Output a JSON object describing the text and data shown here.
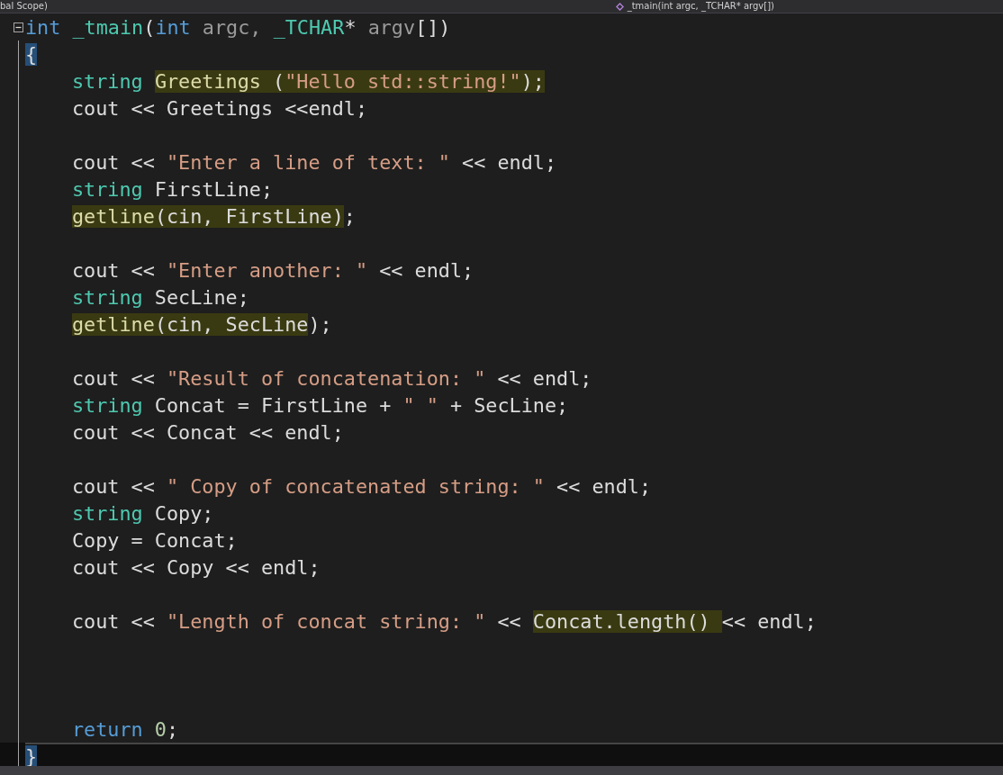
{
  "navigation_bar": {
    "scope": "bal Scope)",
    "member": "_tmain(int argc, _TCHAR* argv[])"
  },
  "lines": [
    {
      "foldable": true,
      "current": false,
      "tokens": [
        {
          "kind": "keyword",
          "text": "int"
        },
        {
          "kind": "identifier",
          "text": " _tmain"
        },
        {
          "kind": "plain",
          "text": "("
        },
        {
          "kind": "keyword",
          "text": "int"
        },
        {
          "kind": "param",
          "text": " argc, "
        },
        {
          "kind": "type",
          "text": "_TCHAR"
        },
        {
          "kind": "plain",
          "text": "* "
        },
        {
          "kind": "param",
          "text": "argv"
        },
        {
          "kind": "plain",
          "text": "[])"
        }
      ]
    },
    {
      "foldable": false,
      "current": false,
      "tokens": [
        {
          "kind": "brace-match",
          "text": "{"
        }
      ],
      "children": [
        {
          "foldable": false,
          "current": false,
          "tokens": [
            {
              "kind": "type",
              "text": "string "
            },
            {
              "kind": "function",
              "text": "Greetings",
              "highlight": true
            },
            {
              "kind": "plain",
              "text": " (",
              "highlight": true
            },
            {
              "kind": "string",
              "text": "\"Hello std::string!\"",
              "highlight": true
            },
            {
              "kind": "plain",
              "text": ");",
              "highlight": true
            }
          ]
        },
        {
          "foldable": false,
          "current": false,
          "tokens": [
            {
              "kind": "plain",
              "text": "cout << Greetings <<endl;"
            }
          ]
        },
        {
          "foldable": false,
          "current": false
        },
        {
          "foldable": false,
          "current": false,
          "tokens": [
            {
              "kind": "plain",
              "text": "cout << "
            },
            {
              "kind": "string",
              "text": "\"Enter a line of text: \""
            },
            {
              "kind": "plain",
              "text": " << endl;"
            }
          ]
        },
        {
          "foldable": false,
          "current": false,
          "tokens": [
            {
              "kind": "type",
              "text": "string"
            },
            {
              "kind": "plain",
              "text": " FirstLine;"
            }
          ]
        },
        {
          "foldable": false,
          "current": false,
          "tokens": [
            {
              "kind": "function",
              "text": "getline",
              "highlight": true
            },
            {
              "kind": "plain",
              "text": "(cin, FirstLine)",
              "highlight": true
            },
            {
              "kind": "plain",
              "text": ";"
            }
          ]
        },
        {
          "foldable": false,
          "current": false
        },
        {
          "foldable": false,
          "current": false,
          "tokens": [
            {
              "kind": "plain",
              "text": "cout << "
            },
            {
              "kind": "string",
              "text": "\"Enter another: \""
            },
            {
              "kind": "plain",
              "text": " << endl;"
            }
          ]
        },
        {
          "foldable": false,
          "current": false,
          "tokens": [
            {
              "kind": "type",
              "text": "string"
            },
            {
              "kind": "plain",
              "text": " SecLine;"
            }
          ]
        },
        {
          "foldable": false,
          "current": false,
          "tokens": [
            {
              "kind": "function",
              "text": "getline",
              "highlight": true
            },
            {
              "kind": "plain",
              "text": "(cin, SecLine",
              "highlight": true
            },
            {
              "kind": "plain",
              "text": ");"
            }
          ]
        },
        {
          "foldable": false,
          "current": false
        },
        {
          "foldable": false,
          "current": false,
          "tokens": [
            {
              "kind": "plain",
              "text": "cout << "
            },
            {
              "kind": "string",
              "text": "\"Result of concatenation: \""
            },
            {
              "kind": "plain",
              "text": " << endl;"
            }
          ]
        },
        {
          "foldable": false,
          "current": false,
          "tokens": [
            {
              "kind": "type",
              "text": "string"
            },
            {
              "kind": "plain",
              "text": " Concat = FirstLine + "
            },
            {
              "kind": "string",
              "text": "\" \""
            },
            {
              "kind": "plain",
              "text": " + SecLine;"
            }
          ]
        },
        {
          "foldable": false,
          "current": false,
          "tokens": [
            {
              "kind": "plain",
              "text": "cout << Concat << endl;"
            }
          ]
        },
        {
          "foldable": false,
          "current": false
        },
        {
          "foldable": false,
          "current": false,
          "tokens": [
            {
              "kind": "plain",
              "text": "cout << "
            },
            {
              "kind": "string",
              "text": "\" Copy of concatenated string: \""
            },
            {
              "kind": "plain",
              "text": " << endl;"
            }
          ]
        },
        {
          "foldable": false,
          "current": false,
          "tokens": [
            {
              "kind": "type",
              "text": "string"
            },
            {
              "kind": "plain",
              "text": " Copy;"
            }
          ]
        },
        {
          "foldable": false,
          "current": false,
          "tokens": [
            {
              "kind": "plain",
              "text": "Copy = Concat;"
            }
          ]
        },
        {
          "foldable": false,
          "current": false,
          "tokens": [
            {
              "kind": "plain",
              "text": "cout << Copy << endl;"
            }
          ]
        },
        {
          "foldable": false,
          "current": false
        },
        {
          "foldable": false,
          "current": false,
          "tokens": [
            {
              "kind": "plain",
              "text": "cout << "
            },
            {
              "kind": "string",
              "text": "\"Length of concat string: \""
            },
            {
              "kind": "plain",
              "text": " << "
            },
            {
              "kind": "plain",
              "text": "Concat.length() ",
              "highlight": true
            },
            {
              "kind": "plain",
              "text": "<< endl;"
            }
          ]
        },
        {
          "foldable": false,
          "current": false
        },
        {
          "foldable": false,
          "current": false
        },
        {
          "foldable": false,
          "current": false
        },
        {
          "foldable": false,
          "current": false,
          "tokens": [
            {
              "kind": "keyword",
              "text": "return"
            },
            {
              "kind": "number",
              "text": " 0"
            },
            {
              "kind": "plain",
              "text": ";"
            }
          ]
        }
      ]
    },
    {
      "foldable": false,
      "current": true,
      "tokens": [
        {
          "kind": "brace-match",
          "text": "}"
        }
      ]
    }
  ]
}
